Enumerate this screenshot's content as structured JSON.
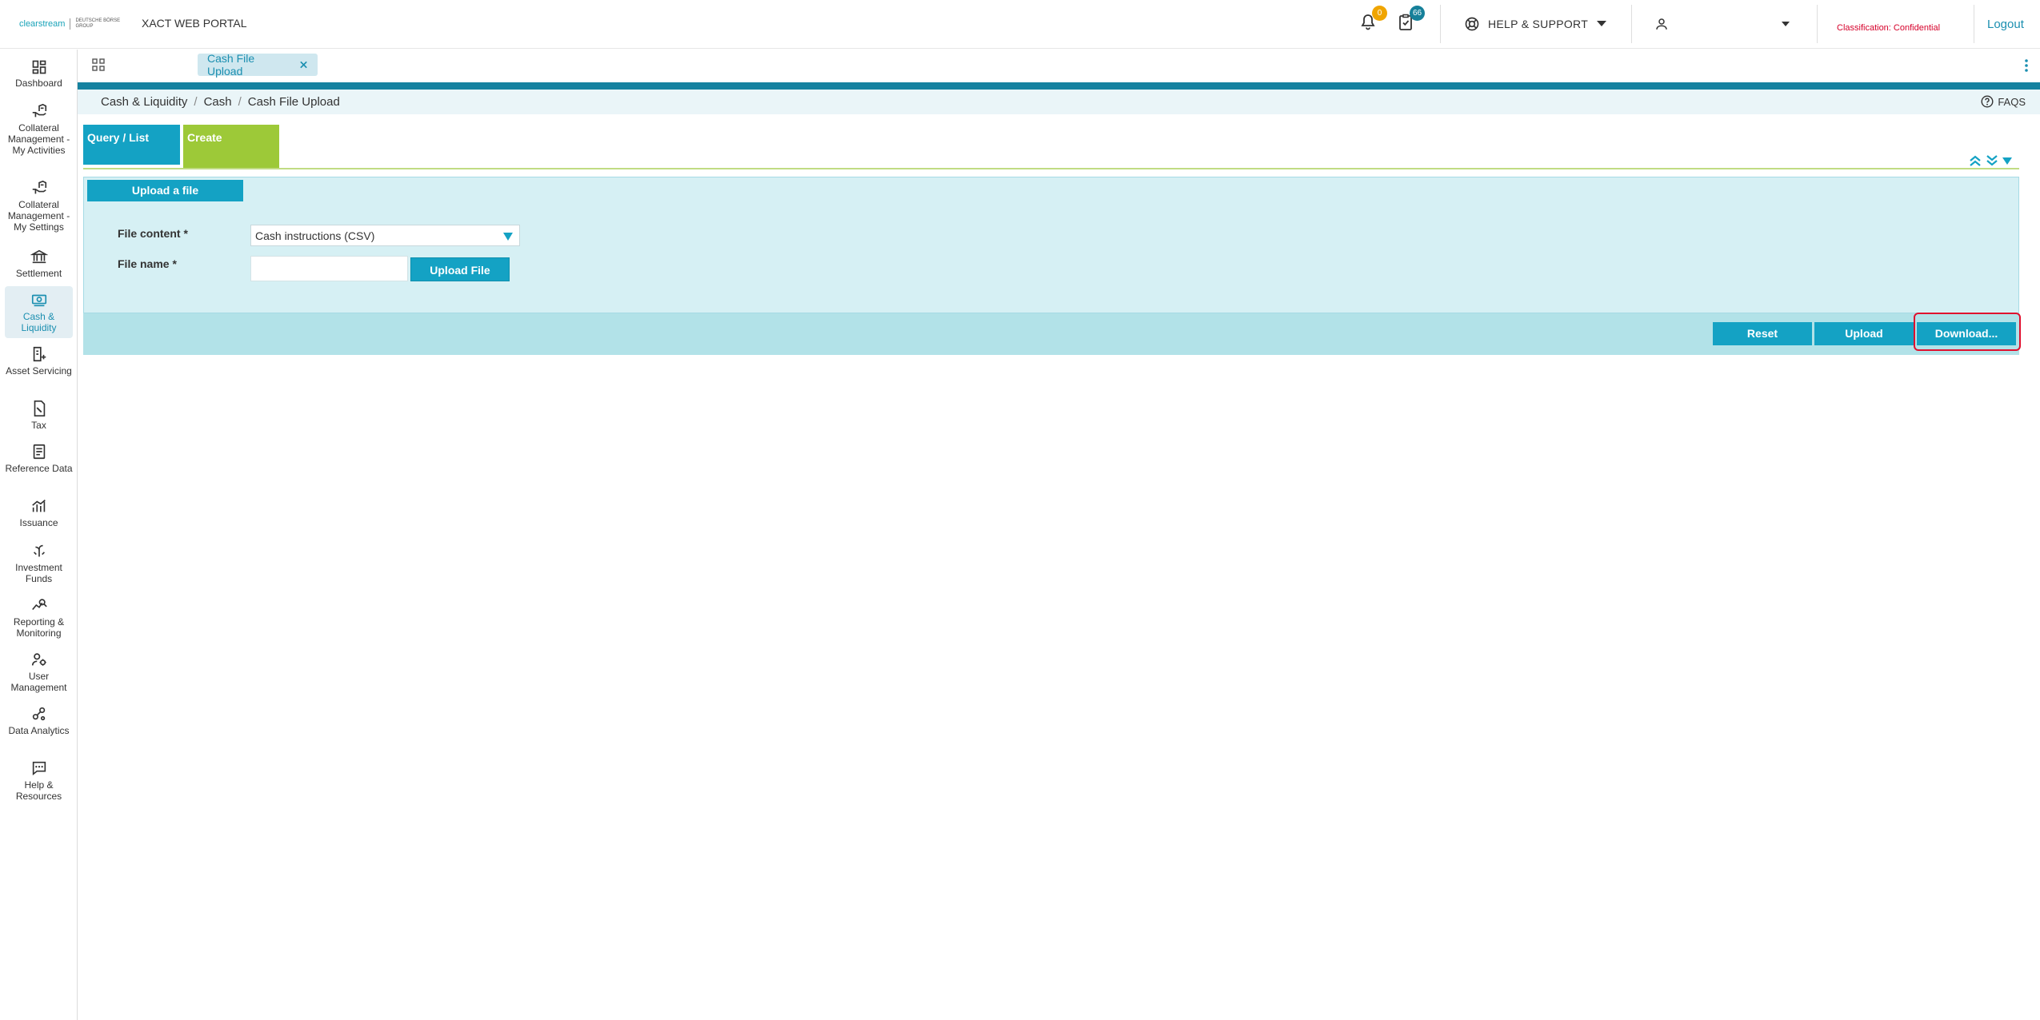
{
  "header": {
    "logo_brand": "clearstream",
    "logo_group": "DEUTSCHE BÖRSE GROUP",
    "portal_title": "XACT WEB PORTAL",
    "notifications_count": "0",
    "tasks_count": "66",
    "help_label": "HELP & SUPPORT",
    "classification": "Classification: Confidential",
    "logout_label": "Logout"
  },
  "sidebar": {
    "items": [
      {
        "label": "Dashboard"
      },
      {
        "label": "Collateral Management - My Activities"
      },
      {
        "label": "Collateral Management - My Settings"
      },
      {
        "label": "Settlement"
      },
      {
        "label": "Cash & Liquidity"
      },
      {
        "label": "Asset Servicing"
      },
      {
        "label": "Tax"
      },
      {
        "label": "Reference Data"
      },
      {
        "label": "Issuance"
      },
      {
        "label": "Investment Funds"
      },
      {
        "label": "Reporting & Monitoring"
      },
      {
        "label": "User Management"
      },
      {
        "label": "Data Analytics"
      },
      {
        "label": "Help & Resources"
      }
    ]
  },
  "tabstrip": {
    "open_tab_label": "Cash File Upload"
  },
  "breadcrumb": {
    "items": [
      "Cash & Liquidity",
      "Cash",
      "Cash File Upload"
    ],
    "faqs_label": "FAQS"
  },
  "main_tabs": {
    "query_label": "Query / List",
    "create_label": "Create"
  },
  "panel": {
    "title": "Upload a file",
    "file_content_label": "File content *",
    "file_content_value": "Cash instructions (CSV)",
    "file_name_label": "File name *",
    "file_name_value": "",
    "upload_file_label": "Upload File"
  },
  "actions": {
    "reset_label": "Reset",
    "upload_label": "Upload",
    "download_label": "Download..."
  },
  "colors": {
    "accent": "#14a2c4",
    "create_tab": "#9dc938",
    "highlight": "#e0102e"
  }
}
